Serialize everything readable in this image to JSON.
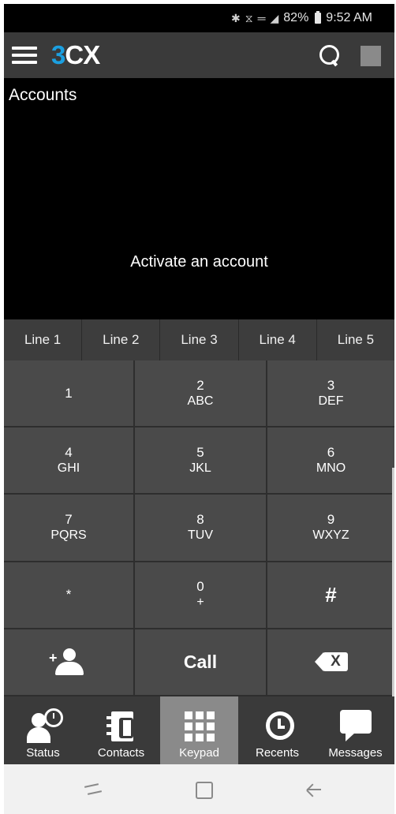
{
  "status_bar": {
    "icons": [
      "bluetooth-icon",
      "alarm-icon",
      "lte-icon",
      "signal-icon"
    ],
    "battery": "82%",
    "time": "9:52 AM"
  },
  "app_bar": {
    "logo_part1": "3",
    "logo_part2": "CX",
    "brand_color": "#1b9fe0",
    "icons": [
      "hamburger-icon",
      "search-icon",
      "avatar-icon"
    ]
  },
  "accounts": {
    "title": "Accounts",
    "empty_message": "Activate an account"
  },
  "line_tabs": [
    "Line 1",
    "Line 2",
    "Line 3",
    "Line 4",
    "Line 5"
  ],
  "keypad": {
    "keys": [
      {
        "digit": "1",
        "letters": ""
      },
      {
        "digit": "2",
        "letters": "ABC"
      },
      {
        "digit": "3",
        "letters": "DEF"
      },
      {
        "digit": "4",
        "letters": "GHI"
      },
      {
        "digit": "5",
        "letters": "JKL"
      },
      {
        "digit": "6",
        "letters": "MNO"
      },
      {
        "digit": "7",
        "letters": "PQRS"
      },
      {
        "digit": "8",
        "letters": "TUV"
      },
      {
        "digit": "9",
        "letters": "WXYZ"
      },
      {
        "digit": "*",
        "letters": ""
      },
      {
        "digit": "0",
        "letters": "+"
      },
      {
        "digit": "#",
        "letters": ""
      }
    ],
    "add_contact_plus": "+",
    "call_label": "Call",
    "backspace_x": "X"
  },
  "bottom_nav": [
    {
      "label": "Status",
      "icon": "status-icon"
    },
    {
      "label": "Contacts",
      "icon": "contacts-icon"
    },
    {
      "label": "Keypad",
      "icon": "keypad-icon",
      "active": true
    },
    {
      "label": "Recents",
      "icon": "recents-icon"
    },
    {
      "label": "Messages",
      "icon": "messages-icon"
    }
  ],
  "system_nav": [
    "recent-apps-icon",
    "home-icon",
    "back-icon"
  ]
}
